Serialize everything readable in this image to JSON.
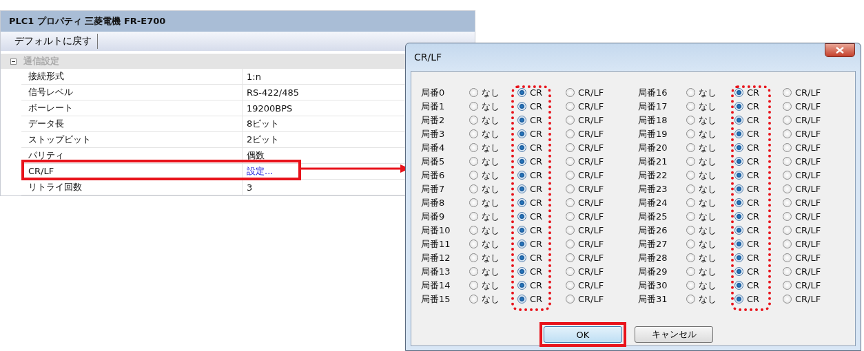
{
  "property_window": {
    "title": "PLC1 プロパティ 三菱電機 FR-E700",
    "toolbar": [
      {
        "label": "デフォルトに戻す"
      }
    ],
    "category": {
      "label": "通信設定",
      "expanded": true,
      "rows": [
        {
          "name": "接続形式",
          "value": "1:n",
          "kind": "text"
        },
        {
          "name": "信号レベル",
          "value": "RS-422/485",
          "kind": "text"
        },
        {
          "name": "ボーレート",
          "value": "19200BPS",
          "kind": "text"
        },
        {
          "name": "データ長",
          "value": "8ビット",
          "kind": "text"
        },
        {
          "name": "ストップビット",
          "value": "2ビット",
          "kind": "text"
        },
        {
          "name": "パリティ",
          "value": "偶数",
          "kind": "text"
        },
        {
          "name": "CR/LF",
          "value": "設定...",
          "kind": "link"
        },
        {
          "name": "リトライ回数",
          "value": "3",
          "kind": "text"
        }
      ]
    }
  },
  "dialog": {
    "title": "CR/LF",
    "groups": [
      {
        "stations": [
          {
            "label": "局番0",
            "options": [
              {
                "label": "なし",
                "selected": false
              },
              {
                "label": "CR",
                "selected": true
              },
              {
                "label": "CR/LF",
                "selected": false
              }
            ]
          },
          {
            "label": "局番1",
            "options": [
              {
                "label": "なし",
                "selected": false
              },
              {
                "label": "CR",
                "selected": true
              },
              {
                "label": "CR/LF",
                "selected": false
              }
            ]
          },
          {
            "label": "局番2",
            "options": [
              {
                "label": "なし",
                "selected": false
              },
              {
                "label": "CR",
                "selected": true
              },
              {
                "label": "CR/LF",
                "selected": false
              }
            ]
          },
          {
            "label": "局番3",
            "options": [
              {
                "label": "なし",
                "selected": false
              },
              {
                "label": "CR",
                "selected": true
              },
              {
                "label": "CR/LF",
                "selected": false
              }
            ]
          },
          {
            "label": "局番4",
            "options": [
              {
                "label": "なし",
                "selected": false
              },
              {
                "label": "CR",
                "selected": true
              },
              {
                "label": "CR/LF",
                "selected": false
              }
            ]
          },
          {
            "label": "局番5",
            "options": [
              {
                "label": "なし",
                "selected": false
              },
              {
                "label": "CR",
                "selected": true
              },
              {
                "label": "CR/LF",
                "selected": false
              }
            ]
          },
          {
            "label": "局番6",
            "options": [
              {
                "label": "なし",
                "selected": false
              },
              {
                "label": "CR",
                "selected": true
              },
              {
                "label": "CR/LF",
                "selected": false
              }
            ]
          },
          {
            "label": "局番7",
            "options": [
              {
                "label": "なし",
                "selected": false
              },
              {
                "label": "CR",
                "selected": true
              },
              {
                "label": "CR/LF",
                "selected": false
              }
            ]
          },
          {
            "label": "局番8",
            "options": [
              {
                "label": "なし",
                "selected": false
              },
              {
                "label": "CR",
                "selected": true
              },
              {
                "label": "CR/LF",
                "selected": false
              }
            ]
          },
          {
            "label": "局番9",
            "options": [
              {
                "label": "なし",
                "selected": false
              },
              {
                "label": "CR",
                "selected": true
              },
              {
                "label": "CR/LF",
                "selected": false
              }
            ]
          },
          {
            "label": "局番10",
            "options": [
              {
                "label": "なし",
                "selected": false
              },
              {
                "label": "CR",
                "selected": true
              },
              {
                "label": "CR/LF",
                "selected": false
              }
            ]
          },
          {
            "label": "局番11",
            "options": [
              {
                "label": "なし",
                "selected": false
              },
              {
                "label": "CR",
                "selected": true
              },
              {
                "label": "CR/LF",
                "selected": false
              }
            ]
          },
          {
            "label": "局番12",
            "options": [
              {
                "label": "なし",
                "selected": false
              },
              {
                "label": "CR",
                "selected": true
              },
              {
                "label": "CR/LF",
                "selected": false
              }
            ]
          },
          {
            "label": "局番13",
            "options": [
              {
                "label": "なし",
                "selected": false
              },
              {
                "label": "CR",
                "selected": true
              },
              {
                "label": "CR/LF",
                "selected": false
              }
            ]
          },
          {
            "label": "局番14",
            "options": [
              {
                "label": "なし",
                "selected": false
              },
              {
                "label": "CR",
                "selected": true
              },
              {
                "label": "CR/LF",
                "selected": false
              }
            ]
          },
          {
            "label": "局番15",
            "options": [
              {
                "label": "なし",
                "selected": false
              },
              {
                "label": "CR",
                "selected": true
              },
              {
                "label": "CR/LF",
                "selected": false
              }
            ]
          }
        ]
      },
      {
        "stations": [
          {
            "label": "局番16",
            "options": [
              {
                "label": "なし",
                "selected": false
              },
              {
                "label": "CR",
                "selected": true
              },
              {
                "label": "CR/LF",
                "selected": false
              }
            ]
          },
          {
            "label": "局番17",
            "options": [
              {
                "label": "なし",
                "selected": false
              },
              {
                "label": "CR",
                "selected": true
              },
              {
                "label": "CR/LF",
                "selected": false
              }
            ]
          },
          {
            "label": "局番18",
            "options": [
              {
                "label": "なし",
                "selected": false
              },
              {
                "label": "CR",
                "selected": true
              },
              {
                "label": "CR/LF",
                "selected": false
              }
            ]
          },
          {
            "label": "局番19",
            "options": [
              {
                "label": "なし",
                "selected": false
              },
              {
                "label": "CR",
                "selected": true
              },
              {
                "label": "CR/LF",
                "selected": false
              }
            ]
          },
          {
            "label": "局番20",
            "options": [
              {
                "label": "なし",
                "selected": false
              },
              {
                "label": "CR",
                "selected": true
              },
              {
                "label": "CR/LF",
                "selected": false
              }
            ]
          },
          {
            "label": "局番21",
            "options": [
              {
                "label": "なし",
                "selected": false
              },
              {
                "label": "CR",
                "selected": true
              },
              {
                "label": "CR/LF",
                "selected": false
              }
            ]
          },
          {
            "label": "局番22",
            "options": [
              {
                "label": "なし",
                "selected": false
              },
              {
                "label": "CR",
                "selected": true
              },
              {
                "label": "CR/LF",
                "selected": false
              }
            ]
          },
          {
            "label": "局番23",
            "options": [
              {
                "label": "なし",
                "selected": false
              },
              {
                "label": "CR",
                "selected": true
              },
              {
                "label": "CR/LF",
                "selected": false
              }
            ]
          },
          {
            "label": "局番24",
            "options": [
              {
                "label": "なし",
                "selected": false
              },
              {
                "label": "CR",
                "selected": true
              },
              {
                "label": "CR/LF",
                "selected": false
              }
            ]
          },
          {
            "label": "局番25",
            "options": [
              {
                "label": "なし",
                "selected": false
              },
              {
                "label": "CR",
                "selected": true
              },
              {
                "label": "CR/LF",
                "selected": false
              }
            ]
          },
          {
            "label": "局番26",
            "options": [
              {
                "label": "なし",
                "selected": false
              },
              {
                "label": "CR",
                "selected": true
              },
              {
                "label": "CR/LF",
                "selected": false
              }
            ]
          },
          {
            "label": "局番27",
            "options": [
              {
                "label": "なし",
                "selected": false
              },
              {
                "label": "CR",
                "selected": true
              },
              {
                "label": "CR/LF",
                "selected": false
              }
            ]
          },
          {
            "label": "局番28",
            "options": [
              {
                "label": "なし",
                "selected": false
              },
              {
                "label": "CR",
                "selected": true
              },
              {
                "label": "CR/LF",
                "selected": false
              }
            ]
          },
          {
            "label": "局番29",
            "options": [
              {
                "label": "なし",
                "selected": false
              },
              {
                "label": "CR",
                "selected": true
              },
              {
                "label": "CR/LF",
                "selected": false
              }
            ]
          },
          {
            "label": "局番30",
            "options": [
              {
                "label": "なし",
                "selected": false
              },
              {
                "label": "CR",
                "selected": true
              },
              {
                "label": "CR/LF",
                "selected": false
              }
            ]
          },
          {
            "label": "局番31",
            "options": [
              {
                "label": "なし",
                "selected": false
              },
              {
                "label": "CR",
                "selected": true
              },
              {
                "label": "CR/LF",
                "selected": false
              }
            ]
          }
        ]
      }
    ],
    "buttons": [
      {
        "label": "OK",
        "kind": "default"
      },
      {
        "label": "キャンセル",
        "kind": "normal"
      }
    ]
  }
}
